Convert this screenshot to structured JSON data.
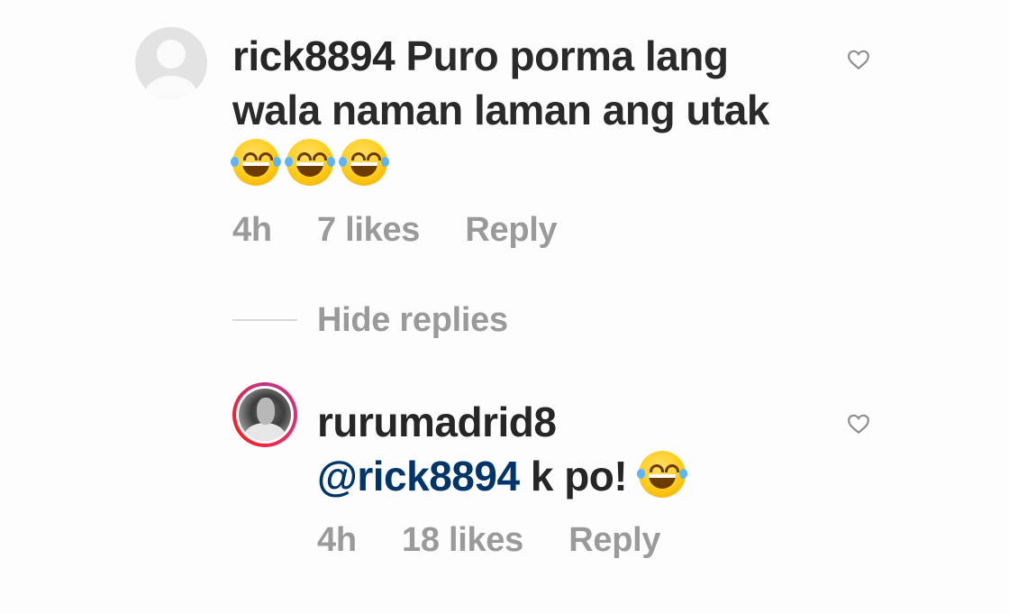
{
  "comment": {
    "username": "rick8894",
    "text": "Puro porma lang wala naman laman ang utak",
    "emoji_count": 3,
    "emoji": "face-with-tears-of-joy",
    "time": "4h",
    "likes": "7 likes",
    "reply_label": "Reply"
  },
  "hide_replies_label": "Hide replies",
  "reply": {
    "username": "rurumadrid8",
    "mention": "@rick8894",
    "text": " k po! ",
    "emoji": "face-with-tears-of-joy",
    "time": "4h",
    "likes": "18 likes",
    "reply_label": "Reply"
  },
  "colors": {
    "text": "#262626",
    "meta": "#9a9a9a",
    "mention": "#003569"
  }
}
